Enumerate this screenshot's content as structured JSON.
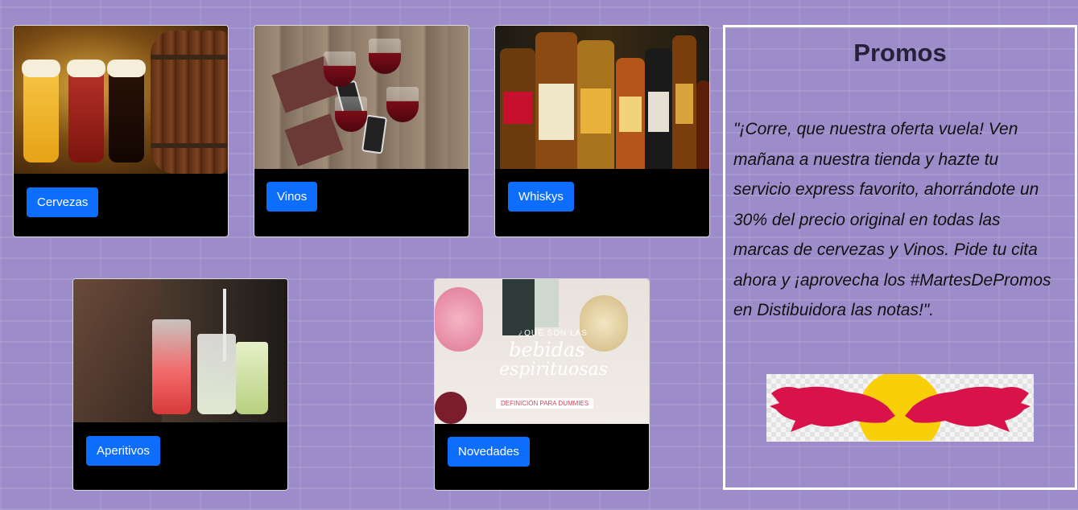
{
  "cards": [
    {
      "label": "Cervezas",
      "image_icon": "beer-glasses-barrel-image"
    },
    {
      "label": "Vinos",
      "image_icon": "wine-glasses-toast-image"
    },
    {
      "label": "Whiskys",
      "image_icon": "whisky-bottles-image"
    },
    {
      "label": "Aperitivos",
      "image_icon": "cocktail-drinks-image"
    },
    {
      "label": "Novedades",
      "image_icon": "spirits-drinks-image"
    }
  ],
  "novedades_image_text": {
    "line1": "¿QUÉ SON LAS",
    "line2": "bebidas",
    "line3": "espirituosas",
    "line4": "DEFINICIÓN PARA DUMMIES"
  },
  "promos": {
    "title": "Promos",
    "text": "\"¡Corre, que nuestra oferta vuela! Ven mañana a nuestra tienda y hazte tu servicio express favorito, ahorrándote un 30% del precio original en todas las marcas de cervezas y Vinos. Pide tu cita ahora y ¡aprovecha los #MartesDePromos en Distibuidora las notas!\".",
    "logo_icon": "red-bull-logo"
  },
  "colors": {
    "background": "#9c8dca",
    "button": "#0d6efd",
    "card": "#000000",
    "title": "#25213a",
    "logo_red": "#d9134a",
    "logo_yellow": "#f9cf0a"
  }
}
